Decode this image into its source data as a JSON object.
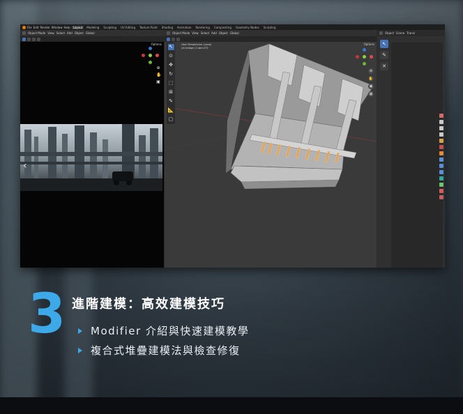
{
  "menu": {
    "items": [
      "File",
      "Edit",
      "Render",
      "Window",
      "Help"
    ],
    "workspaces": [
      "Layout",
      "Modeling",
      "Sculpting",
      "UV Editing",
      "Texture Paint",
      "Shading",
      "Animation",
      "Rendering",
      "Compositing",
      "Geometry Nodes",
      "Scripting"
    ],
    "active_workspace": "Layout"
  },
  "left_pane": {
    "mode": "Object Mode",
    "menu": [
      "View",
      "Select",
      "Add",
      "Object"
    ],
    "transform": "Global",
    "options": "Options"
  },
  "viewport": {
    "mode": "Object Mode",
    "menu": [
      "View",
      "Select",
      "Add",
      "Object"
    ],
    "transform": "Global",
    "options": "Options",
    "info_line1": "User Perspective (Local)",
    "info_line2": "(4) bridge | Cube.073"
  },
  "properties": {
    "header_label": "Object",
    "extra": [
      "Scene",
      "Transl"
    ]
  },
  "overlay": {
    "number": "3",
    "heading": "進階建模：高效建模技巧",
    "bullets": [
      "Modifier 介紹與快速建模教學",
      "複合式堆疊建模法與檢查修復"
    ],
    "accent_color": "#3ea9e8"
  }
}
